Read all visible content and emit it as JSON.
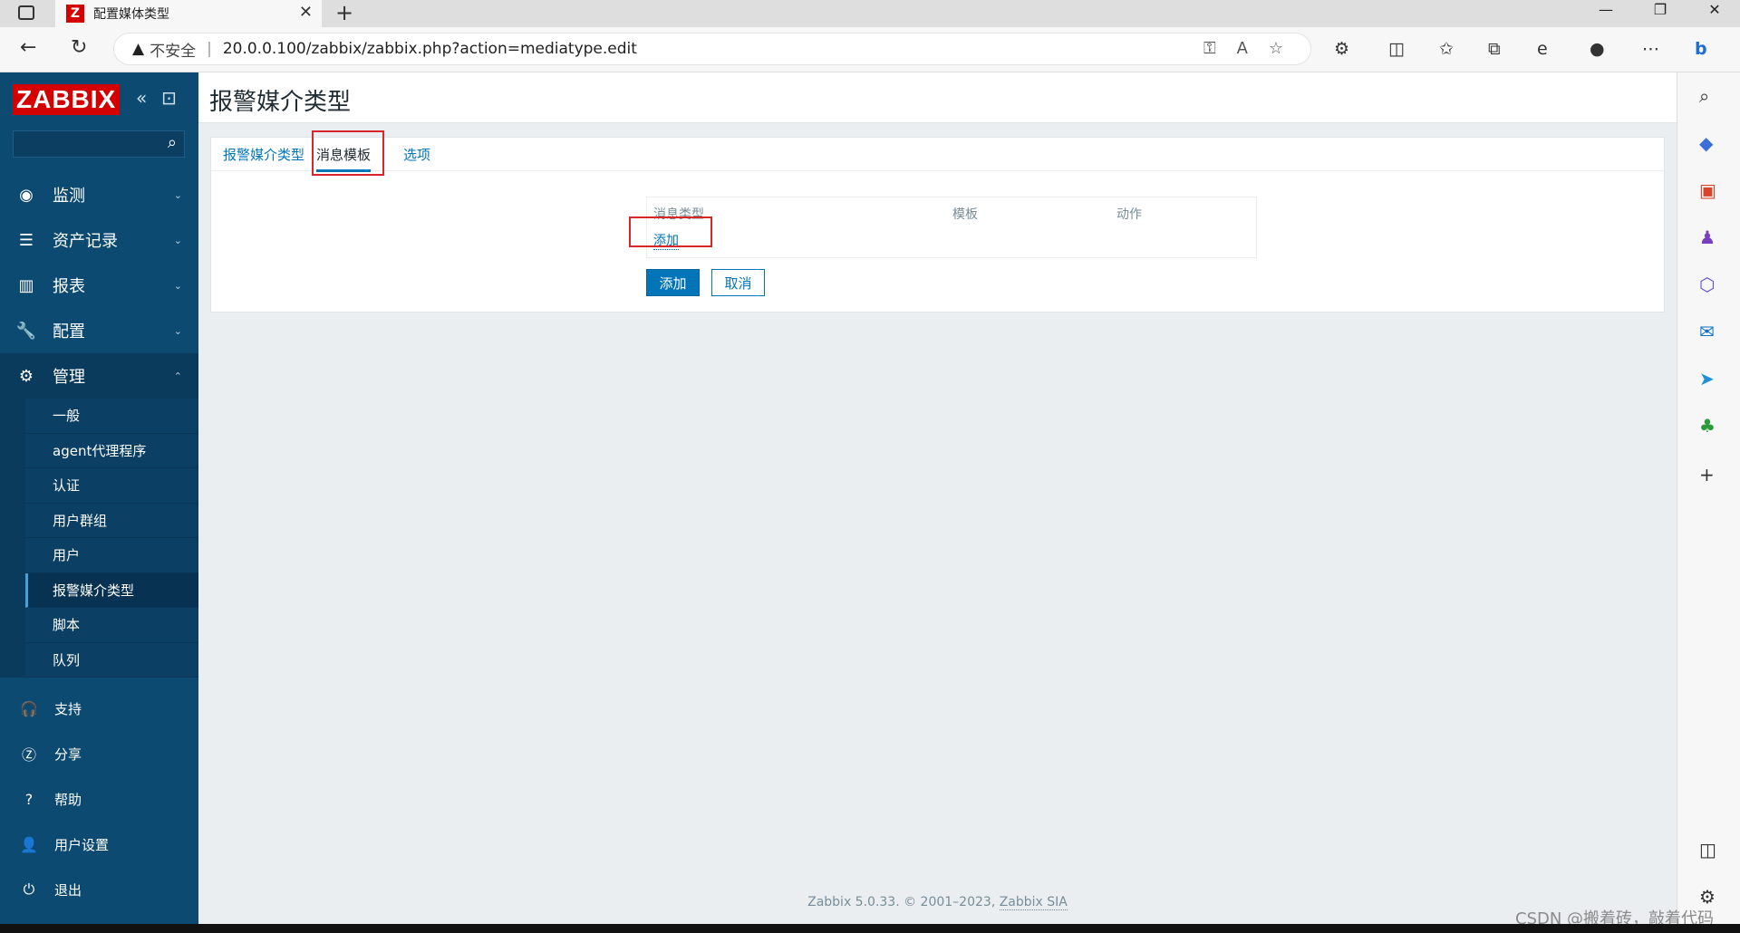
{
  "browser": {
    "tab_title": "配置媒体类型",
    "tab_icon_letter": "Z",
    "new_tab": "+",
    "close_tab": "✕",
    "security_label": "不安全",
    "url": "20.0.0.100/zabbix/zabbix.php?action=mediatype.edit",
    "window_controls": [
      "—",
      "❐",
      "✕"
    ]
  },
  "sidebar": {
    "logo": "ZABBIX",
    "search_placeholder": "",
    "menu": [
      {
        "label": "监测",
        "icon": "eye-icon",
        "expanded": false
      },
      {
        "label": "资产记录",
        "icon": "list-icon",
        "expanded": false
      },
      {
        "label": "报表",
        "icon": "chart-icon",
        "expanded": false
      },
      {
        "label": "配置",
        "icon": "wrench-icon",
        "expanded": false
      },
      {
        "label": "管理",
        "icon": "gear-icon",
        "expanded": true
      }
    ],
    "submenu": [
      "一般",
      "agent代理程序",
      "认证",
      "用户群组",
      "用户",
      "报警媒介类型",
      "脚本",
      "队列"
    ],
    "submenu_selected": "报警媒介类型",
    "bottom": [
      {
        "label": "支持",
        "icon": "headset-icon"
      },
      {
        "label": "分享",
        "icon": "share-icon"
      },
      {
        "label": "帮助",
        "icon": "help-icon"
      },
      {
        "label": "用户设置",
        "icon": "user-icon"
      },
      {
        "label": "退出",
        "icon": "power-icon"
      }
    ]
  },
  "main": {
    "page_title": "报警媒介类型",
    "tabs": [
      "报警媒介类型",
      "消息模板",
      "选项"
    ],
    "active_tab": "消息模板",
    "table": {
      "headers": [
        "消息类型",
        "模板",
        "动作"
      ],
      "add_link": "添加"
    },
    "buttons": {
      "add": "添加",
      "cancel": "取消"
    },
    "footer": {
      "text": "Zabbix 5.0.33. © 2001–2023, ",
      "link": "Zabbix SIA"
    }
  },
  "watermark": "CSDN @搬着砖，敲着代码",
  "colors": {
    "sidebar_bg": "#0d4a72",
    "accent": "#0275b8",
    "logo_red": "#d40000",
    "highlight_box": "#d9262a"
  }
}
